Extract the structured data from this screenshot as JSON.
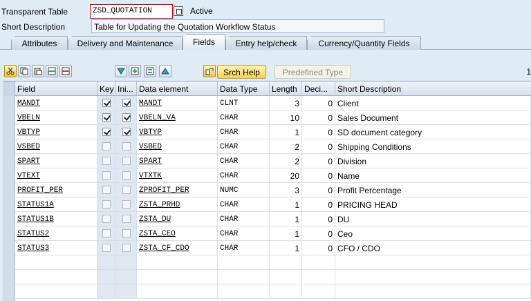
{
  "header": {
    "table_label": "Transparent Table",
    "table_name": "ZSD_QUOTATION",
    "status": "Active",
    "desc_label": "Short Description",
    "description": "Table for Updating the Quotation Workflow Status"
  },
  "tabs": [
    {
      "label": "Attributes",
      "active": false
    },
    {
      "label": "Delivery and Maintenance",
      "active": false
    },
    {
      "label": "Fields",
      "active": true
    },
    {
      "label": "Entry help/check",
      "active": false
    },
    {
      "label": "Currency/Quantity Fields",
      "active": false
    }
  ],
  "toolbar": {
    "srch_help": "Srch Help",
    "predefined_type": "Predefined Type",
    "right_text": "1"
  },
  "columns": {
    "field": "Field",
    "key": "Key",
    "init": "Ini...",
    "data_element": "Data element",
    "data_type": "Data Type",
    "length": "Length",
    "decimals": "Deci...",
    "short_desc": "Short Description"
  },
  "rows": [
    {
      "field": "MANDT",
      "key": true,
      "init": true,
      "data_element": "MANDT",
      "data_type": "CLNT",
      "length": "3",
      "decimals": "0",
      "short_desc": "Client"
    },
    {
      "field": "VBELN",
      "key": true,
      "init": true,
      "data_element": "VBELN_VA",
      "data_type": "CHAR",
      "length": "10",
      "decimals": "0",
      "short_desc": "Sales Document"
    },
    {
      "field": "VBTYP",
      "key": true,
      "init": true,
      "data_element": "VBTYP",
      "data_type": "CHAR",
      "length": "1",
      "decimals": "0",
      "short_desc": "SD document category"
    },
    {
      "field": "VSBED",
      "key": false,
      "init": false,
      "data_element": "VSBED",
      "data_type": "CHAR",
      "length": "2",
      "decimals": "0",
      "short_desc": "Shipping Conditions"
    },
    {
      "field": "SPART",
      "key": false,
      "init": false,
      "data_element": "SPART",
      "data_type": "CHAR",
      "length": "2",
      "decimals": "0",
      "short_desc": "Division"
    },
    {
      "field": "VTEXT",
      "key": false,
      "init": false,
      "data_element": "VTXTK",
      "data_type": "CHAR",
      "length": "20",
      "decimals": "0",
      "short_desc": "Name"
    },
    {
      "field": "PROFIT_PER",
      "key": false,
      "init": false,
      "data_element": "ZPROFIT_PER",
      "data_type": "NUMC",
      "length": "3",
      "decimals": "0",
      "short_desc": "Profit Percentage"
    },
    {
      "field": "STATUS1A",
      "key": false,
      "init": false,
      "data_element": "ZSTA_PRHD",
      "data_type": "CHAR",
      "length": "1",
      "decimals": "0",
      "short_desc": "PRICING HEAD"
    },
    {
      "field": "STATUS1B",
      "key": false,
      "init": false,
      "data_element": "ZSTA_DU",
      "data_type": "CHAR",
      "length": "1",
      "decimals": "0",
      "short_desc": "DU"
    },
    {
      "field": "STATUS2",
      "key": false,
      "init": false,
      "data_element": "ZSTA_CEO",
      "data_type": "CHAR",
      "length": "1",
      "decimals": "0",
      "short_desc": "Ceo"
    },
    {
      "field": "STATUS3",
      "key": false,
      "init": false,
      "data_element": "ZSTA_CF_CDO",
      "data_type": "CHAR",
      "length": "1",
      "decimals": "0",
      "short_desc": "CFO / CDO"
    }
  ]
}
